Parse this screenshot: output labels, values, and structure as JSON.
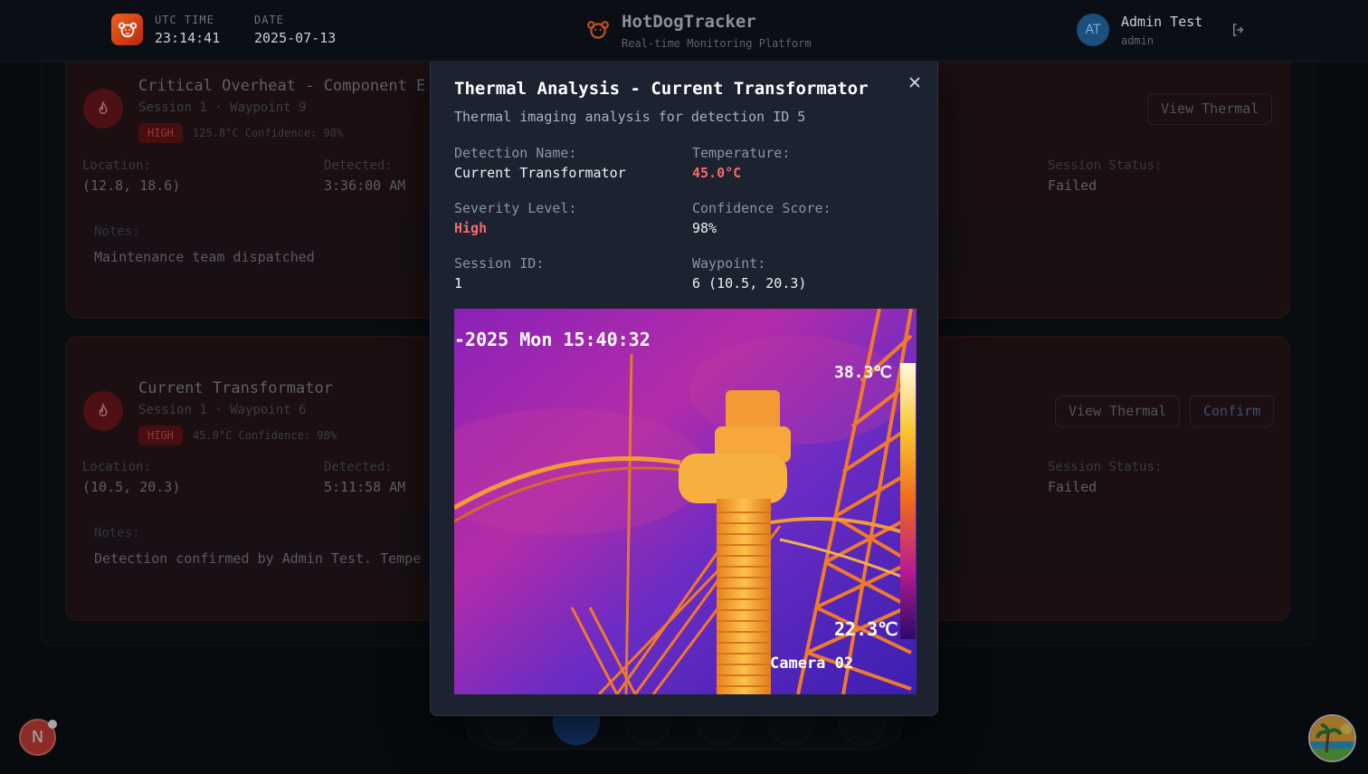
{
  "header": {
    "utc_label": "UTC TIME",
    "utc_value": "23:14:41",
    "date_label": "DATE",
    "date_value": "2025-07-13",
    "brand_title": "HotDogTracker",
    "brand_subtitle": "Real-time Monitoring Platform",
    "user_initials": "AT",
    "user_name": "Admin Test",
    "user_role": "admin"
  },
  "cards": [
    {
      "title": "Critical Overheat - Component E",
      "subtitle": "Session 1 · Waypoint 9",
      "severity": "HIGH",
      "temp_confidence": "125.8°C Confidence: 98%",
      "location_label": "Location:",
      "location_value": "(12.8, 18.6)",
      "detected_label": "Detected:",
      "detected_value": "3:36:00 AM",
      "session_status_label": "Session Status:",
      "session_status_value": "Failed",
      "notes_label": "Notes:",
      "notes_text": "Maintenance team dispatched",
      "view_thermal_label": "View Thermal"
    },
    {
      "title": "Current Transformator",
      "subtitle": "Session 1 · Waypoint 6",
      "severity": "HIGH",
      "temp_confidence": "45.0°C Confidence: 98%",
      "location_label": "Location:",
      "location_value": "(10.5, 20.3)",
      "detected_label": "Detected:",
      "detected_value": "5:11:58 AM",
      "session_status_label": "Session Status:",
      "session_status_value": "Failed",
      "notes_label": "Notes:",
      "notes_text": "Detection confirmed by Admin Test. Tempe",
      "view_thermal_label": "View Thermal",
      "confirm_label": "Confirm"
    }
  ],
  "modal": {
    "title": "Thermal Analysis - Current Transformator",
    "description": "Thermal imaging analysis for detection ID 5",
    "detection_name_label": "Detection Name:",
    "detection_name_value": "Current Transformator",
    "temperature_label": "Temperature:",
    "temperature_value": "45.0°C",
    "severity_label": "Severity Level:",
    "severity_value": "High",
    "confidence_label": "Confidence Score:",
    "confidence_value": "98%",
    "session_label": "Session ID:",
    "session_value": "1",
    "waypoint_label": "Waypoint:",
    "waypoint_value": "6 (10.5, 20.3)",
    "image_overlay": {
      "timestamp": "-2025 Mon 15:40:32",
      "max_temp": "38.3℃",
      "min_temp": "22.3℃",
      "camera": "Camera 02"
    }
  },
  "colors": {
    "accent_red": "#f46b6b",
    "severity_pill": "#6d161a",
    "modal_bg": "#1c2230"
  },
  "icons": {
    "logo": "dog-face-icon",
    "logout": "logout-icon",
    "close": "close-icon",
    "flame": "flame-icon"
  }
}
